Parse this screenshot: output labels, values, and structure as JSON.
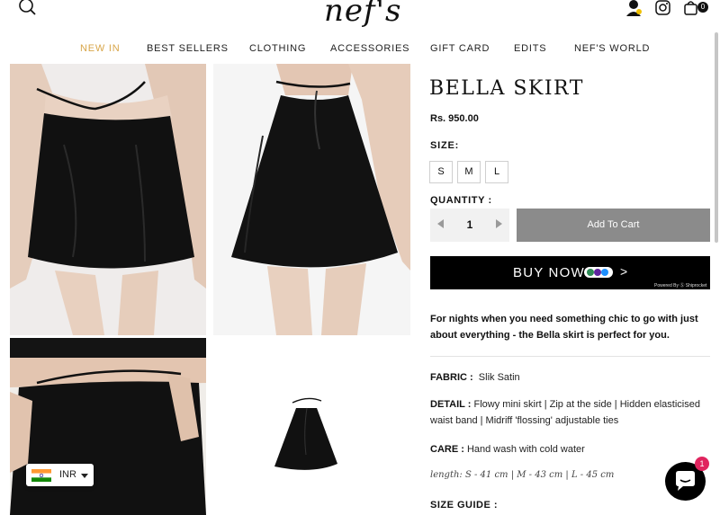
{
  "header": {
    "logo_text": "nef's",
    "cart_count": "0"
  },
  "nav": {
    "items": [
      {
        "label": "NEW IN",
        "active": true
      },
      {
        "label": "BEST SELLERS"
      },
      {
        "label": "CLOTHING"
      },
      {
        "label": "ACCESSORIES"
      },
      {
        "label": "GIFT CARD"
      },
      {
        "label": "EDITS"
      },
      {
        "label": "NEF'S WORLD"
      }
    ]
  },
  "currency": {
    "code": "INR"
  },
  "product": {
    "title": "BELLA SKIRT",
    "price": "Rs. 950.00",
    "size_label": "SIZE:",
    "sizes": [
      "S",
      "M",
      "L"
    ],
    "quantity_label": "QUANTITY :",
    "quantity": "1",
    "add_to_cart": "Add To Cart",
    "buy_now": "BUY NOW",
    "buy_now_arrow": ">",
    "powered_by": "Powered By Ⓢ Shiprocket",
    "tagline": "For nights when you need something chic to go with just about everything - the Bella skirt is perfect for you.",
    "fabric_label": "FABRIC :",
    "fabric": "Slik Satin",
    "detail_label": "DETAIL :",
    "detail": "Flowy mini skirt | Zip at the side | Hidden elasticised waist band | Midriff 'flossing' adjustable ties",
    "care_label": "CARE :",
    "care": "Hand wash with cold water",
    "length": "length: S - 41 cm | M - 43 cm | L - 45 cm",
    "size_guide": "SIZE GUIDE :"
  },
  "chat": {
    "badge": "1"
  },
  "colors": {
    "accent": "#d8a64a",
    "add_to_cart_bg": "#8b8b8b",
    "buy_now_bg": "#000000",
    "chat_badge": "#e0245e"
  },
  "icons": [
    "search-icon",
    "account-icon",
    "instagram-icon",
    "cart-icon",
    "india-flag-icon",
    "caret-down-icon",
    "chat-icon",
    "arrow-left-icon",
    "arrow-right-icon"
  ]
}
